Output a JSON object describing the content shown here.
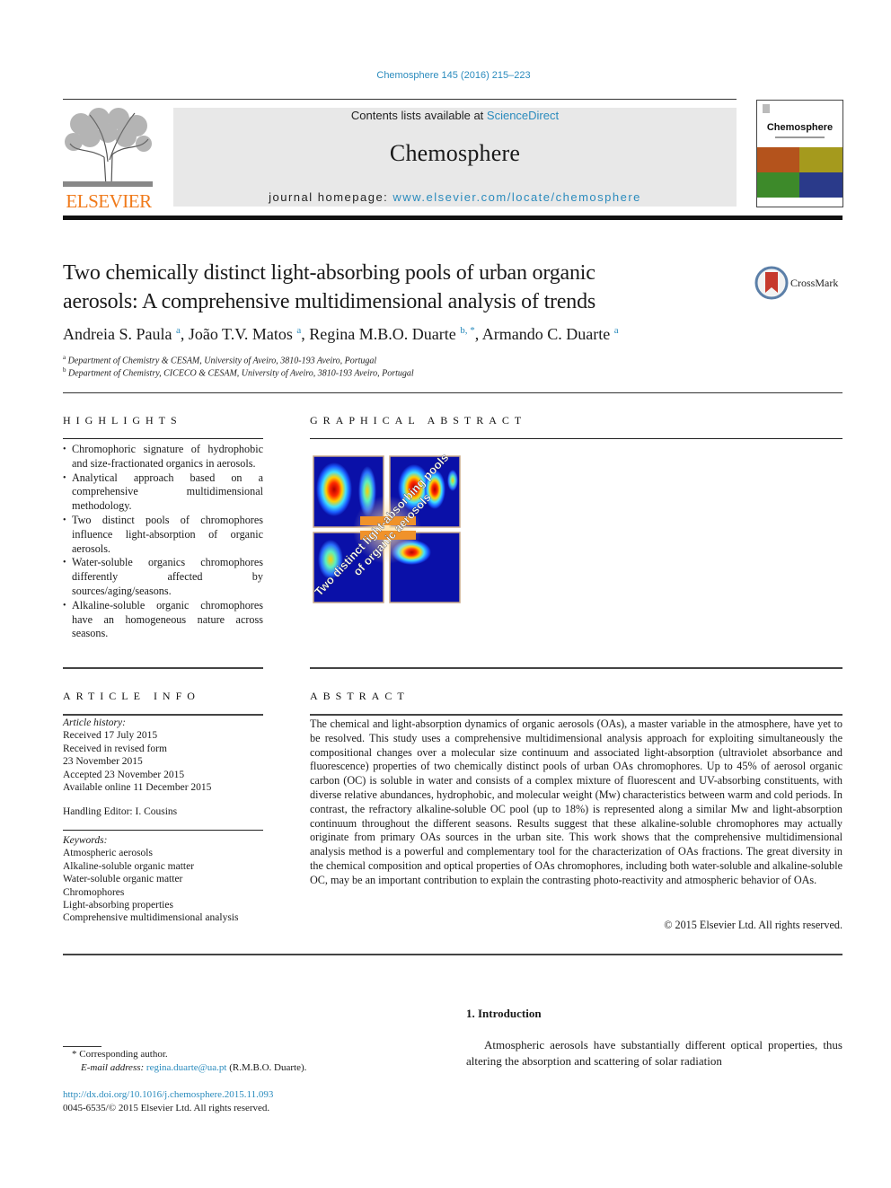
{
  "header": {
    "citation": "Chemosphere 145 (2016) 215–223",
    "publisher": "ELSEVIER",
    "contents_prefix": "Contents lists available at ",
    "contents_link": "ScienceDirect",
    "journal_name": "Chemosphere",
    "homepage_prefix": "journal homepage: ",
    "homepage_link": "www.elsevier.com/locate/chemosphere",
    "cover_title": "Chemosphere",
    "cover_colors": [
      "#b4531c",
      "#a59a1d",
      "#3d8a2a",
      "#2a3a8a"
    ]
  },
  "article": {
    "title_line1": "Two chemically distinct light-absorbing pools of urban organic",
    "title_line2": "aerosols: A comprehensive multidimensional analysis of trends",
    "crossmark_label": "CrossMark",
    "authors": [
      {
        "name": "Andreia S. Paula",
        "sup": "a"
      },
      {
        "name": "João T.V. Matos",
        "sup": "a"
      },
      {
        "name": "Regina M.B.O. Duarte",
        "sup": "b, *"
      },
      {
        "name": "Armando C. Duarte",
        "sup": "a"
      }
    ],
    "affiliations": [
      {
        "sup": "a",
        "text": "Department of Chemistry & CESAM, University of Aveiro, 3810-193 Aveiro, Portugal"
      },
      {
        "sup": "b",
        "text": "Department of Chemistry, CICECO & CESAM, University of Aveiro, 3810-193 Aveiro, Portugal"
      }
    ]
  },
  "highlights": {
    "heading": "HIGHLIGHTS",
    "items": [
      "Chromophoric signature of hydrophobic and size-fractionated organics in aerosols.",
      "Analytical approach based on a comprehensive multidimensional methodology.",
      "Two distinct pools of chromophores influence light-absorption of organic aerosols.",
      "Water-soluble organics chromophores differently affected by sources/aging/seasons.",
      "Alkaline-soluble organic chromophores have an homogeneous nature across seasons."
    ]
  },
  "graphical_abstract": {
    "heading": "GRAPHICAL ABSTRACT",
    "overlay_line1": "Two distinct light-absorbing pools",
    "overlay_line2": "of organic aerosols"
  },
  "article_info": {
    "heading": "ARTICLE INFO",
    "history_label": "Article history:",
    "history": [
      "Received 17 July 2015",
      "Received in revised form",
      "23 November 2015",
      "Accepted 23 November 2015",
      "Available online 11 December 2015"
    ],
    "handling_editor": "Handling Editor: I. Cousins",
    "keywords_label": "Keywords:",
    "keywords": [
      "Atmospheric aerosols",
      "Alkaline-soluble organic matter",
      "Water-soluble organic matter",
      "Chromophores",
      "Light-absorbing properties",
      "Comprehensive multidimensional analysis"
    ]
  },
  "abstract": {
    "heading": "ABSTRACT",
    "text": "The chemical and light-absorption dynamics of organic aerosols (OAs), a master variable in the atmosphere, have yet to be resolved. This study uses a comprehensive multidimensional analysis approach for exploiting simultaneously the compositional changes over a molecular size continuum and associated light-absorption (ultraviolet absorbance and fluorescence) properties of two chemically distinct pools of urban OAs chromophores. Up to 45% of aerosol organic carbon (OC) is soluble in water and consists of a complex mixture of fluorescent and UV-absorbing constituents, with diverse relative abundances, hydrophobic, and molecular weight (Mw) characteristics between warm and cold periods. In contrast, the refractory alkaline-soluble OC pool (up to 18%) is represented along a similar Mw and light-absorption continuum throughout the different seasons. Results suggest that these alkaline-soluble chromophores may actually originate from primary OAs sources in the urban site. This work shows that the comprehensive multidimensional analysis method is a powerful and complementary tool for the characterization of OAs fractions. The great diversity in the chemical composition and optical properties of OAs chromophores, including both water-soluble and alkaline-soluble OC, may be an important contribution to explain the contrasting photo-reactivity and atmospheric behavior of OAs.",
    "copyright": "© 2015 Elsevier Ltd. All rights reserved."
  },
  "introduction": {
    "heading": "1.  Introduction",
    "text": "Atmospheric aerosols have substantially different optical properties, thus altering the absorption and scattering of solar radiation"
  },
  "footnotes": {
    "corresponding": "* Corresponding author.",
    "email_label": "E-mail address: ",
    "email": "regina.duarte@ua.pt",
    "email_suffix": " (R.M.B.O. Duarte).",
    "doi": "http://dx.doi.org/10.1016/j.chemosphere.2015.11.093",
    "issn_copyright": "0045-6535/© 2015 Elsevier Ltd. All rights reserved."
  }
}
